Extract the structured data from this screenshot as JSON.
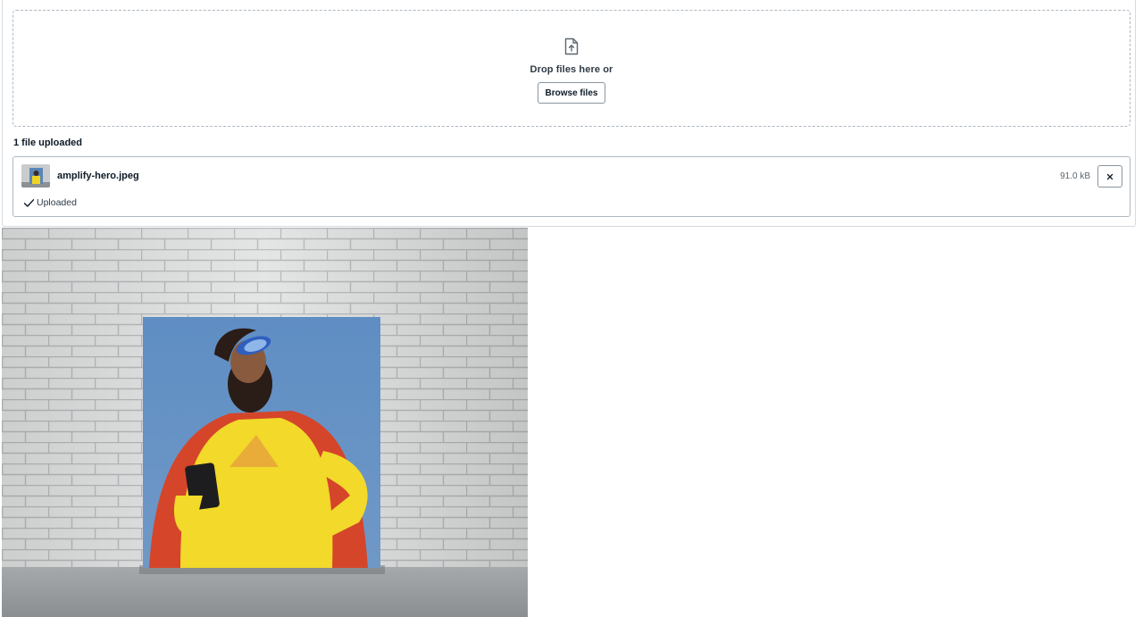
{
  "dropzone": {
    "icon": "file-upload-icon",
    "text": "Drop files here or",
    "browse_label": "Browse files"
  },
  "upload_summary": {
    "label": "1 file uploaded"
  },
  "files": [
    {
      "name": "amplify-hero.jpeg",
      "size": "91.0 kB",
      "status": "Uploaded",
      "status_icon": "checkmark-icon",
      "remove_icon": "close-icon"
    }
  ],
  "colors": {
    "border": "#aeb8c2",
    "text": "#0d1a26",
    "muted": "#5c6670"
  }
}
